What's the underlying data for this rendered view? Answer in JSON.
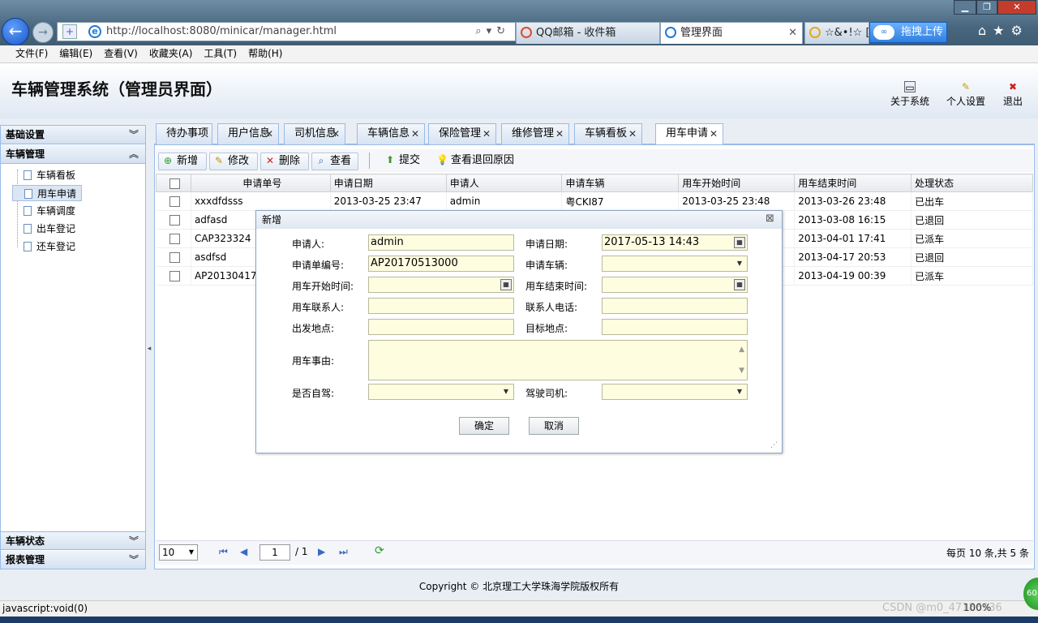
{
  "browser": {
    "url": "http://localhost:8080/minicar/manager.html",
    "tabs": [
      {
        "label": "QQ邮箱 - 收件箱",
        "active": false
      },
      {
        "label": "管理界面",
        "active": true
      },
      {
        "label": "☆&•!☆ [",
        "active": false
      }
    ],
    "upload_label": "拖拽上传",
    "menu": [
      "文件(F)",
      "编辑(E)",
      "查看(V)",
      "收藏夹(A)",
      "工具(T)",
      "帮助(H)"
    ],
    "status_text": "javascript:void(0)",
    "zoom": "100%",
    "watermark": "CSDN @m0_47186936",
    "badge": "60"
  },
  "app": {
    "title": "车辆管理系统（管理员界面）",
    "header_buttons": [
      "关于系统",
      "个人设置",
      "退出"
    ],
    "footer": "Copyright © 北京理工大学珠海学院版权所有"
  },
  "sidebar": {
    "sections": [
      "基础设置",
      "车辆管理",
      "车辆状态",
      "报表管理"
    ],
    "items": [
      "车辆看板",
      "用车申请",
      "车辆调度",
      "出车登记",
      "还车登记"
    ],
    "selected": "用车申请"
  },
  "tabs": [
    "待办事项",
    "用户信息",
    "司机信息",
    "车辆信息",
    "保险管理",
    "维修管理",
    "车辆看板",
    "用车申请"
  ],
  "active_tab": "用车申请",
  "toolbar": [
    "新增",
    "修改",
    "删除",
    "查看",
    "提交",
    "查看退回原因"
  ],
  "grid": {
    "columns": [
      "申请单号",
      "申请日期",
      "申请人",
      "申请车辆",
      "用车开始时间",
      "用车结束时间",
      "处理状态"
    ],
    "rows": [
      [
        "xxxdfdsss",
        "2013-03-25 23:47",
        "admin",
        "粤CKI87",
        "2013-03-25 23:48",
        "2013-03-26 23:48",
        "已出车"
      ],
      [
        "adfasd",
        "",
        "",
        "",
        "",
        "2013-03-08 16:15",
        "已退回"
      ],
      [
        "CAP323324",
        "",
        "",
        "",
        "",
        "2013-04-01 17:41",
        "已派车"
      ],
      [
        "asdfsd",
        "",
        "",
        "",
        "",
        "2013-04-17 20:53",
        "已退回"
      ],
      [
        "AP2013041701",
        "",
        "",
        "",
        "",
        "2013-04-19 00:39",
        "已派车"
      ]
    ]
  },
  "pager": {
    "page_size": "10",
    "current": "1",
    "total_pages": "/ 1",
    "summary": "每页 10 条,共 5 条"
  },
  "dialog": {
    "title": "新增",
    "labels": {
      "applicant": "申请人:",
      "apply_date": "申请日期:",
      "form_no": "申请单编号:",
      "vehicle": "申请车辆:",
      "start_time": "用车开始时间:",
      "end_time": "用车结束时间:",
      "contact": "用车联系人:",
      "contact_phone": "联系人电话:",
      "departure": "出发地点:",
      "destination": "目标地点:",
      "reason": "用车事由:",
      "self_drive": "是否自驾:",
      "driver": "驾驶司机:"
    },
    "values": {
      "applicant": "admin",
      "apply_date": "2017-05-13 14:43",
      "form_no": "AP20170513000",
      "vehicle": "",
      "start_time": "",
      "end_time": "",
      "contact": "",
      "contact_phone": "",
      "departure": "",
      "destination": "",
      "reason": "",
      "self_drive": "",
      "driver": ""
    },
    "ok": "确定",
    "cancel": "取消"
  },
  "colors": {
    "accent": "#99bbe8",
    "field_bg": "#fffde0",
    "header_bg": "#dfe8f3"
  }
}
